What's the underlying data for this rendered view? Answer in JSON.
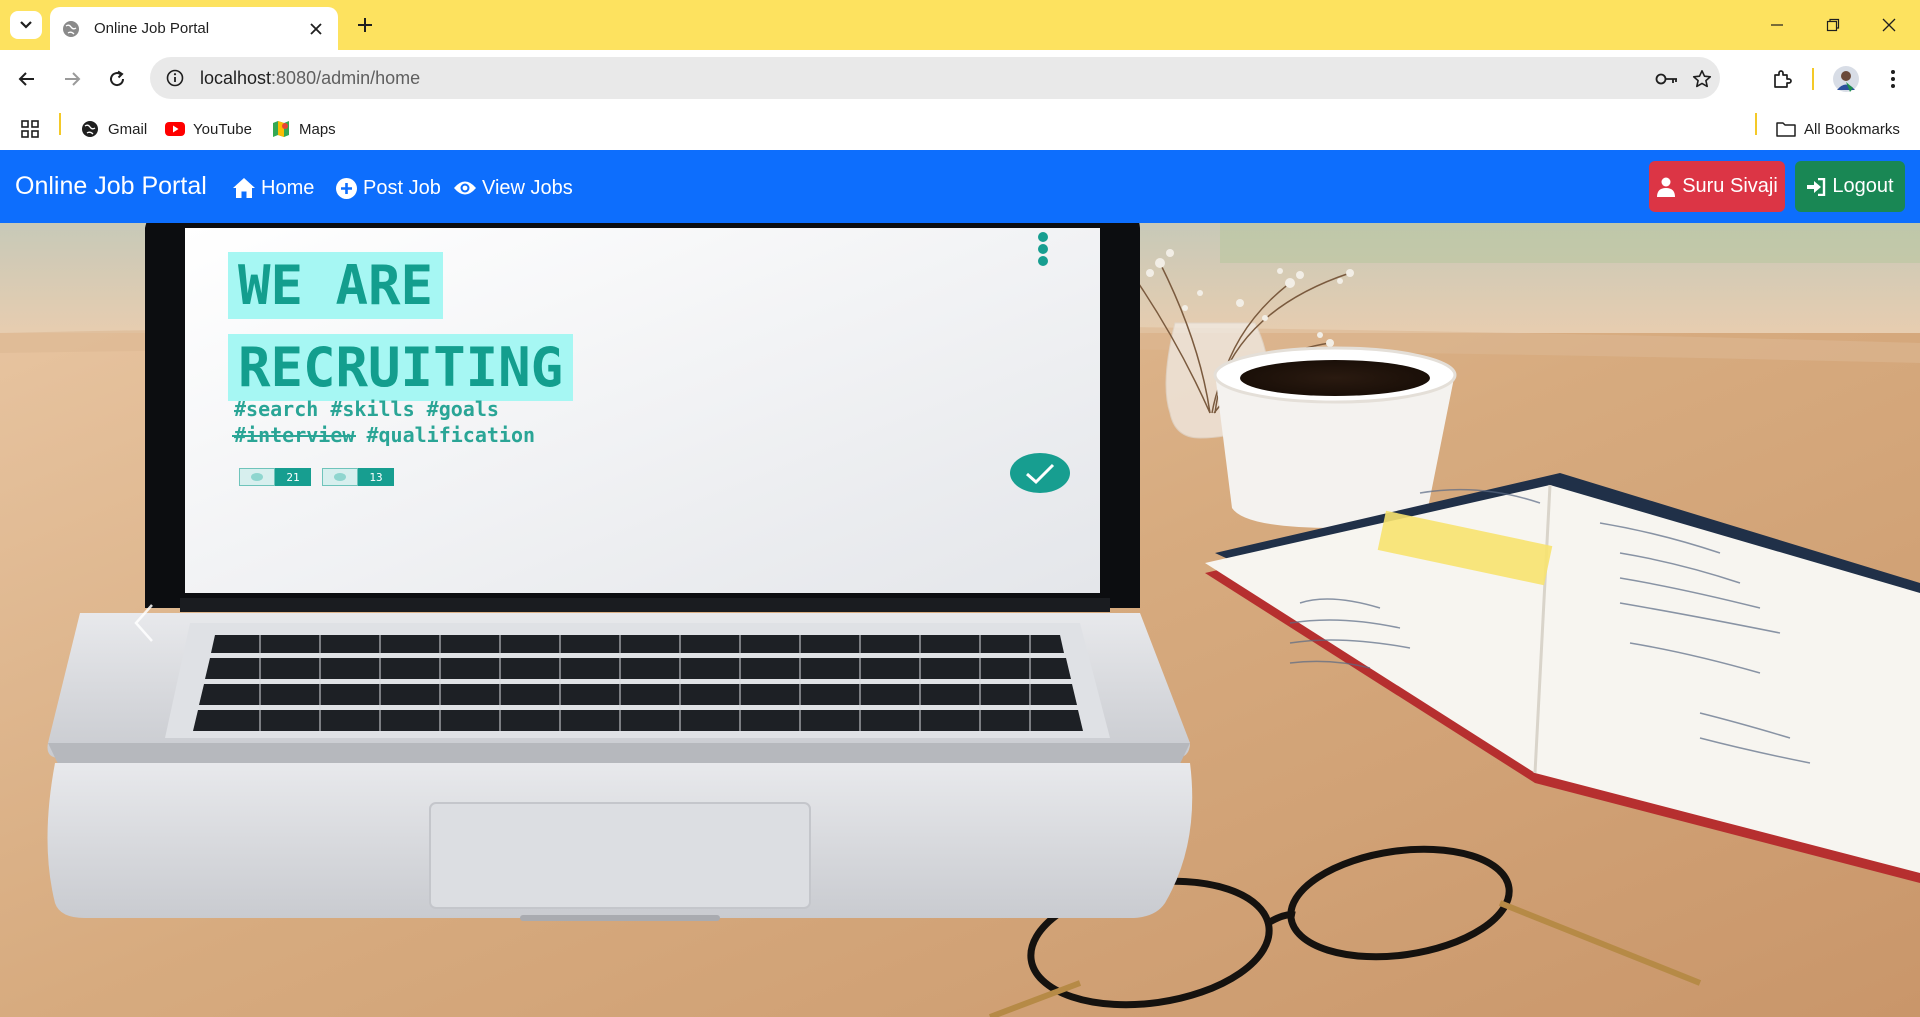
{
  "browser": {
    "tab": {
      "title": "Online Job Portal",
      "favicon": "globe-icon"
    },
    "url": {
      "host": "localhost",
      "path": ":8080/admin/home"
    },
    "bookmarks": [
      {
        "label": "Gmail",
        "icon": "globe-icon"
      },
      {
        "label": "YouTube",
        "icon": "youtube-icon"
      },
      {
        "label": "Maps",
        "icon": "maps-icon"
      }
    ],
    "all_bookmarks": "All Bookmarks"
  },
  "navbar": {
    "brand": "Online Job Portal",
    "links": [
      {
        "label": "Home",
        "icon": "home-icon"
      },
      {
        "label": "Post Job",
        "icon": "plus-circle-icon"
      },
      {
        "label": "View Jobs",
        "icon": "eye-icon"
      }
    ],
    "user_button": "Suru Sivaji",
    "logout_button": "Logout",
    "colors": {
      "navbar": "#0d6efd",
      "user": "#dc3545",
      "logout": "#198754"
    }
  },
  "hero": {
    "line1": "WE ARE",
    "line2": "RECRUITING",
    "tags_line1": "#search #skills #goals",
    "tags_line2": "#interview #qualification",
    "likes": "21",
    "comments": "13"
  }
}
